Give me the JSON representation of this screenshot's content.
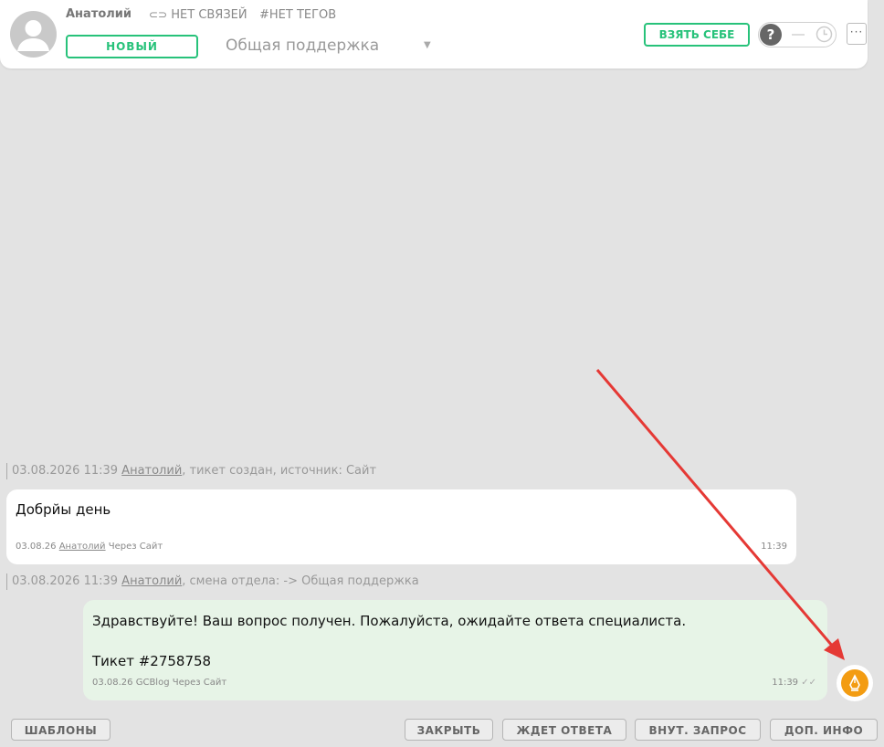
{
  "header": {
    "user_name": "Анатолий",
    "links": "НЕТ СВЯЗЕЙ",
    "tags": "#НЕТ ТЕГОВ",
    "status": "НОВЫЙ",
    "department": "Общая поддержка",
    "take_button": "ВЗЯТЬ СЕБЕ",
    "toggle_knob": "?",
    "more_label": "···"
  },
  "events": [
    {
      "datetime": "03.08.2026 11:39",
      "author": "Анатолий",
      "text": ", тикет создан, источник: Сайт"
    },
    {
      "datetime": "03.08.2026 11:39",
      "author": "Анатолий",
      "text": ", смена отдела: -> Общая поддержка"
    }
  ],
  "messages": [
    {
      "text": "Добрйы день",
      "date": "03.08.26",
      "author": "Анатолий",
      "channel": "Через Сайт",
      "time": "11:39"
    },
    {
      "line1": "Здравствуйте! Ваш вопрос получен. Пожалуйста, ожидайте ответа специалиста.",
      "line2": "Тикет #2758758",
      "date": "03.08.26",
      "author": "GCBlog",
      "channel": "Через Сайт",
      "time": "11:39"
    }
  ],
  "footer": {
    "templates": "ШАБЛОНЫ",
    "close": "ЗАКРЫТЬ",
    "awaiting": "ЖДЕТ ОТВЕТА",
    "internal": "ВНУТ. ЗАПРОС",
    "info": "ДОП. ИНФО"
  },
  "colors": {
    "accent": "#27c27a",
    "agent_avatar": "#f39c12",
    "arrow": "#e53935",
    "outgoing_bubble": "#e7f4e7"
  }
}
